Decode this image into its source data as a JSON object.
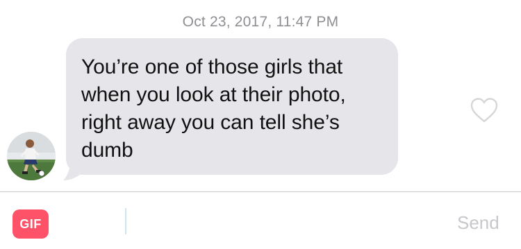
{
  "timestamp": "Oct 23, 2017, 11:47 PM",
  "message": {
    "text": "You’re one of those girls that when you look at their photo, right away you can tell she’s dumb",
    "bubble_color": "#e5e5ea"
  },
  "avatar": {
    "icon": "profile-photo-soccer-player"
  },
  "like": {
    "icon": "heart-outline-icon"
  },
  "composer": {
    "gif_label": "GIF",
    "gif_color": "#fe5268",
    "input_value": "",
    "send_label": "Send"
  }
}
